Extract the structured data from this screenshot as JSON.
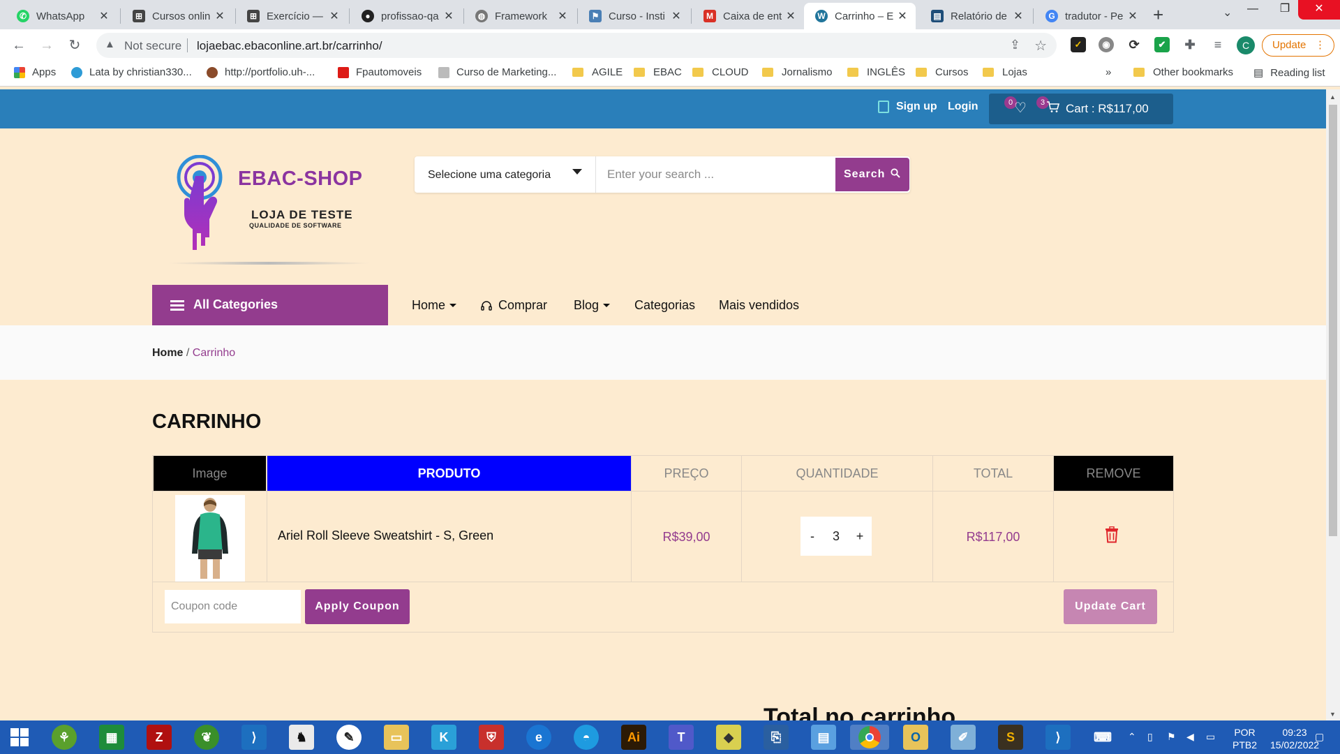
{
  "browser": {
    "tabs": [
      {
        "label": "WhatsApp",
        "icon": "whatsapp-icon",
        "color": "#25d366"
      },
      {
        "label": "Cursos onlin",
        "icon": "network-icon",
        "color": "#444444"
      },
      {
        "label": "Exercício —",
        "icon": "network-icon",
        "color": "#444444"
      },
      {
        "label": "profissao-qa",
        "icon": "github-icon",
        "color": "#222222"
      },
      {
        "label": "Framework",
        "icon": "globe-icon",
        "color": "#777777"
      },
      {
        "label": "Curso - Insti",
        "icon": "flag-icon",
        "color": "#4a7fb5"
      },
      {
        "label": "Caixa de ent",
        "icon": "gmail-icon",
        "color": "#d93025"
      },
      {
        "label": "Carrinho – E",
        "icon": "wordpress-icon",
        "color": "#21759b"
      },
      {
        "label": "Relatório de",
        "icon": "report-icon",
        "color": "#1f4e79"
      },
      {
        "label": "tradutor - Pe",
        "icon": "google-icon",
        "color": "#4285f4"
      }
    ],
    "address": {
      "security": "Not secure",
      "url": "lojaebac.ebaconline.art.br/carrinho/"
    },
    "profile_initial": "C",
    "update_label": "Update",
    "bookmarks": [
      {
        "label": "Apps",
        "type": "apps"
      },
      {
        "label": "Lata by christian330...",
        "type": "site",
        "color": "#2e9bd6"
      },
      {
        "label": "http://portfolio.uh-...",
        "type": "site",
        "color": "#8a4b2a"
      },
      {
        "label": "Fpautomoveis",
        "type": "site",
        "color": "#dd1b16"
      },
      {
        "label": "Curso de Marketing...",
        "type": "site",
        "color": "#999999"
      },
      {
        "label": "AGILE",
        "type": "folder"
      },
      {
        "label": "EBAC",
        "type": "folder"
      },
      {
        "label": "CLOUD",
        "type": "folder"
      },
      {
        "label": "Jornalismo",
        "type": "folder"
      },
      {
        "label": "INGLÊS",
        "type": "folder"
      },
      {
        "label": "Cursos",
        "type": "folder"
      },
      {
        "label": "Lojas",
        "type": "folder"
      }
    ],
    "bookmarks_more": "»",
    "other_bookmarks": "Other bookmarks",
    "reading_list": "Reading list"
  },
  "site": {
    "topbar": {
      "signup": "Sign up",
      "login": "Login",
      "wishlist_count": "0",
      "cart_count": "3",
      "cart_label": "Cart : R$117,00"
    },
    "logo": {
      "title": "EBAC-SHOP",
      "subtitle": "LOJA DE TESTE",
      "tagline": "QUALIDADE DE SOFTWARE"
    },
    "search": {
      "category_selected": "Selecione uma categoria",
      "placeholder": "Enter your search ...",
      "button": "Search"
    },
    "nav": {
      "all_categories": "All Categories",
      "items": [
        "Home",
        "Comprar",
        "Blog",
        "Categorias",
        "Mais vendidos"
      ]
    },
    "breadcrumb": {
      "home": "Home",
      "separator": " / ",
      "current": "Carrinho"
    },
    "page_title": "CARRINHO",
    "cart_table": {
      "headers": [
        "Image",
        "PRODUTO",
        "PREÇO",
        "QUANTIDADE",
        "TOTAL",
        "REMOVE"
      ],
      "rows": [
        {
          "product": "Ariel Roll Sleeve Sweatshirt - S, Green",
          "price": "R$39,00",
          "quantity": "3",
          "total": "R$117,00"
        }
      ],
      "qty_minus": "-",
      "qty_plus": "+",
      "coupon_placeholder": "Coupon code",
      "apply_coupon": "Apply Coupon",
      "update_cart": "Update Cart"
    },
    "totals_title": "Total no carrinho"
  },
  "taskbar": {
    "language": "POR",
    "layout": "PTB2",
    "time": "09:23",
    "date": "15/02/2022"
  },
  "colors": {
    "brand_purple": "#933c8e",
    "topbar_blue": "#2a7fba",
    "page_bg": "#fdebd0",
    "product_header_bg": "#0000ff",
    "dark_header_bg": "#000000"
  }
}
